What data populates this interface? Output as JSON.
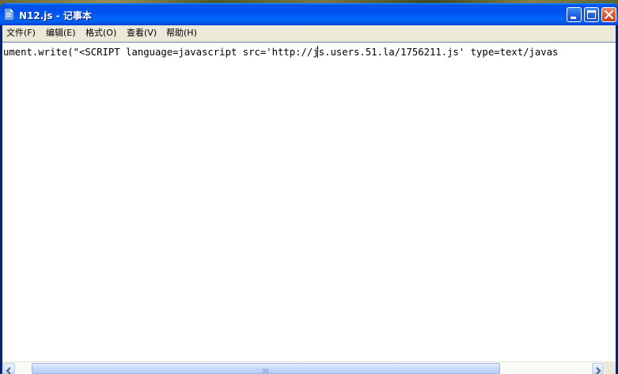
{
  "window": {
    "title": "N12.js - 记事本",
    "icon": "notepad-icon",
    "controls": {
      "minimize": "minimize-icon",
      "maximize": "maximize-icon",
      "close": "close-icon"
    }
  },
  "menu": {
    "items": [
      {
        "label": "文件(F)"
      },
      {
        "label": "编辑(E)"
      },
      {
        "label": "格式(O)"
      },
      {
        "label": "查看(V)"
      },
      {
        "label": "帮助(H)"
      }
    ]
  },
  "editor": {
    "line1": "ument.write(\"<SCRIPT language=javascript src='http://js.users.51.la/1756211.js' type=text/javas"
  },
  "scrollbar": {
    "left_arrow": "arrow-left-icon",
    "right_arrow": "arrow-right-icon",
    "thumb_grip": "grip-icon"
  },
  "colors": {
    "titlebar": "#0053ee",
    "menubar": "#ece9d8",
    "editor_bg": "#ffffff",
    "close_button": "#d9532e"
  }
}
